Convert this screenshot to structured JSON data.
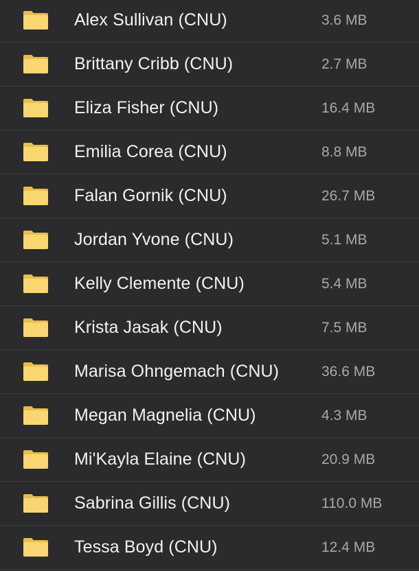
{
  "folders": [
    {
      "name": "Alex Sullivan (CNU)",
      "size": "3.6 MB"
    },
    {
      "name": "Brittany Cribb (CNU)",
      "size": "2.7 MB"
    },
    {
      "name": "Eliza Fisher (CNU)",
      "size": "16.4 MB"
    },
    {
      "name": "Emilia Corea (CNU)",
      "size": "8.8 MB"
    },
    {
      "name": "Falan Gornik (CNU)",
      "size": "26.7 MB"
    },
    {
      "name": "Jordan Yvone (CNU)",
      "size": "5.1 MB"
    },
    {
      "name": "Kelly Clemente (CNU)",
      "size": "5.4 MB"
    },
    {
      "name": "Krista Jasak (CNU)",
      "size": "7.5 MB"
    },
    {
      "name": "Marisa Ohngemach (CNU)",
      "size": "36.6 MB"
    },
    {
      "name": "Megan Magnelia (CNU)",
      "size": "4.3 MB"
    },
    {
      "name": "Mi'Kayla Elaine (CNU)",
      "size": "20.9 MB"
    },
    {
      "name": "Sabrina Gillis (CNU)",
      "size": "110.0 MB"
    },
    {
      "name": "Tessa Boyd (CNU)",
      "size": "12.4 MB"
    }
  ],
  "icons": {
    "folder": "folder-icon"
  },
  "colors": {
    "background": "#2b2b2d",
    "folder_front": "#f9d672",
    "folder_back": "#e9bd4c",
    "name_text": "#f2f2f2",
    "size_text": "#a8a8aa"
  }
}
